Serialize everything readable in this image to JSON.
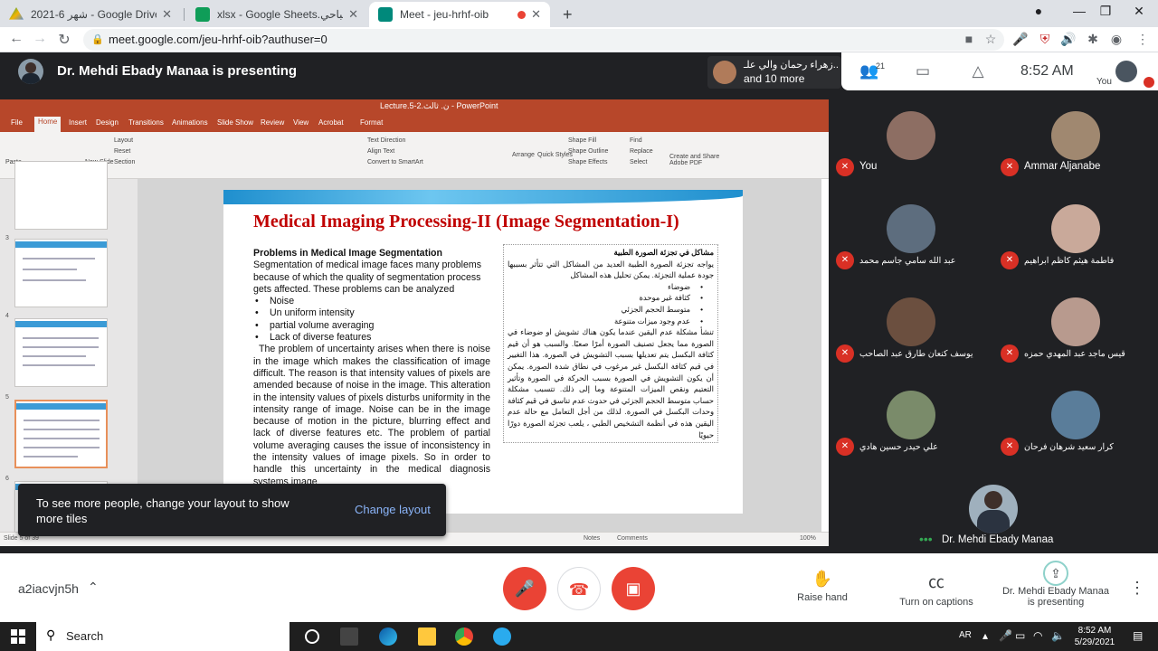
{
  "browser": {
    "tabs": [
      {
        "title": "2021-6 شهر - Google Drive",
        "favicon": "google-drive-icon",
        "color": "#1fa463"
      },
      {
        "title": "xlsx - Google Sheets.الصباحي",
        "favicon": "google-sheets-icon",
        "color": "#0f9d58"
      },
      {
        "title": "Meet - jeu-hrhf-oib",
        "favicon": "google-meet-icon",
        "color": "#00897b"
      }
    ],
    "new_tab": "+",
    "url": "meet.google.com/jeu-hrhf-oib?authuser=0"
  },
  "meet_header": {
    "presenting_title": "Dr. Mehdi Ebady Manaa is presenting",
    "others_line1": "زهراء رحمان والي علـ..",
    "others_line2": "and 10 more",
    "participant_count": "21",
    "clock": "8:52 AM",
    "you_label": "You"
  },
  "presentation": {
    "app_title": "Lecture.5-2.ن. ثالث - PowerPoint",
    "menu": [
      "File",
      "Home",
      "Insert",
      "Design",
      "Transitions",
      "Animations",
      "Slide Show",
      "Review",
      "View",
      "Acrobat",
      "Format"
    ],
    "ribbon_labels": [
      "Paste",
      "New Slide",
      "Layout",
      "Reset",
      "Section",
      "Text Direction",
      "Align Text",
      "Convert to SmartArt",
      "Arrange",
      "Quick Styles",
      "Shape Fill",
      "Shape Outline",
      "Shape Effects",
      "Find",
      "Replace",
      "Select",
      "Create and Share Adobe PDF"
    ],
    "thumb_numbers": [
      "3",
      "4",
      "5",
      "6"
    ],
    "slide_title": "Medical Imaging Processing-II (Image Segmentation-I)",
    "english": {
      "heading": "Problems in Medical Image Segmentation",
      "intro": "Segmentation of medical image faces many problems because of which the quality of segmentation process gets affected. These problems can be analyzed",
      "bullets": [
        "Noise",
        "Un uniform intensity",
        "partial volume averaging",
        "Lack of diverse features"
      ],
      "paragraph": "The problem of uncertainty arises when there is noise in the image which makes the classification of image difficult. The reason is that intensity values of pixels are amended because of noise in the image. This alteration in the intensity values of pixels disturbs uniformity in the intensity range of image. Noise can be in the image because of motion in the picture, blurring effect and lack of diverse features etc. The problem of partial volume averaging causes the issue of inconsistency in the intensity values of image pixels. So in order to handle this uncertainty in the medical diagnosis systems image"
    },
    "arabic": {
      "heading": "مشاكل في تجزئة الصورة الطبية",
      "intro": "يواجه تجزئة الصورة الطبية العديد من المشاكل التي تتأثر بسببها جودة عملية التجزئة. يمكن تحليل هذه المشاكل",
      "bullets": [
        "ضوضاء",
        "كثافة غير موحدة",
        "متوسط الحجم الجزئي",
        "عدم وجود ميزات متنوعة"
      ],
      "paragraph": "تنشأ مشكلة عدم اليقين عندما يكون هناك تشويش او ضوضاء في الصورة مما يجعل تصنيف الصورة أمرًا صعبًا. والسبب هو أن قيم كثافة البكسل يتم تعديلها بسبب التشويش في الصورة. هذا التغيير في قيم كثافة البكسل غير مرغوب في نطاق شدة الصورة. يمكن أن يكون التشويش في الصورة بسبب الحركة في الصورة وتأثير التعتيم ونقص الميزات المتنوعة وما إلى ذلك. تتسبب مشكلة حساب متوسط الحجم الجزئي في حدوث عدم تناسق في قيم كثافة وحدات البكسل في الصورة. لذلك من أجل التعامل مع حالة عدم اليقين هذه في أنظمة التشخيص الطبي ، يلعب تجزئة الصورة دورًا حيويًا"
    },
    "status_left": "Slide 5 of 39",
    "status_notes": "Notes",
    "status_comments": "Comments",
    "status_zoom": "100%"
  },
  "toast": {
    "message": "To see more people, change your layout to show more tiles",
    "action": "Change layout"
  },
  "participants": [
    {
      "name": "You",
      "color": "#8d6e63"
    },
    {
      "name": "Ammar Aljanabe",
      "color": "#a08870"
    },
    {
      "name": "عبد الله سامي جاسم محمد",
      "color": "#5d6d7e"
    },
    {
      "name": "فاطمة هيثم كاظم ابراهيم",
      "color": "#c9a99a"
    },
    {
      "name": "يوسف كنعان طارق عبد الصاحب",
      "color": "#6b4f3f"
    },
    {
      "name": "قيس ماجد عبد المهدي حمزه",
      "color": "#b89a8e"
    },
    {
      "name": "علي حيدر حسين هادي",
      "color": "#7a8b6a"
    },
    {
      "name": "كرار سعيد شرهان فرحان",
      "color": "#5a7d9a"
    }
  ],
  "presenter": {
    "name": "Dr. Mehdi Ebady Manaa"
  },
  "controls": {
    "meeting_code": "a2iacvjn5h",
    "raise_hand": "Raise hand",
    "captions": "Turn on captions",
    "presenting_line1": "Dr. Mehdi Ebady Manaa",
    "presenting_line2": "is presenting"
  },
  "taskbar": {
    "search": "Search",
    "lang": "AR",
    "time": "8:52 AM",
    "date": "5/29/2021"
  },
  "colors": {
    "accent_red": "#ea4335",
    "meet_dark": "#202124",
    "link_blue": "#8ab4f8"
  }
}
